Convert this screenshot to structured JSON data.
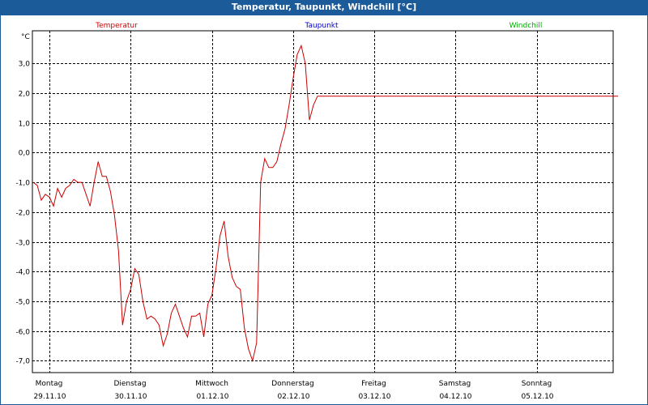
{
  "window": {
    "title": "Temperatur, Taupunkt, Windchill [°C]"
  },
  "colors": {
    "title_bar": "#1b5b9a",
    "temperatur": "#cc0000",
    "taupunkt": "#0000cc",
    "windchill": "#00aa00",
    "grid": "#000000"
  },
  "chart_data": {
    "type": "line",
    "title": "Temperatur, Taupunkt, Windchill [°C]",
    "ylabel": "°C",
    "ylim": [
      -7.4,
      4.1
    ],
    "y_ticks": [
      "3,0",
      "2,0",
      "1,0",
      "0,0",
      "-1,0",
      "-2,0",
      "-3,0",
      "-4,0",
      "-5,0",
      "-6,0",
      "-7,0"
    ],
    "y_tick_values": [
      3,
      2,
      1,
      0,
      -1,
      -2,
      -3,
      -4,
      -5,
      -6,
      -7
    ],
    "xlim": [
      0,
      7
    ],
    "x_ticks": [
      {
        "day": "Montag",
        "date": "29.11.10",
        "x": 0
      },
      {
        "day": "Dienstag",
        "date": "30.11.10",
        "x": 1
      },
      {
        "day": "Mittwoch",
        "date": "01.12.10",
        "x": 2
      },
      {
        "day": "Donnerstag",
        "date": "02.12.10",
        "x": 3
      },
      {
        "day": "Freitag",
        "date": "03.12.10",
        "x": 4
      },
      {
        "day": "Samstag",
        "date": "04.12.10",
        "x": 5
      },
      {
        "day": "Sonntag",
        "date": "05.12.10",
        "x": 6
      }
    ],
    "grid": true,
    "legend": [
      "Temperatur",
      "Taupunkt",
      "Windchill"
    ],
    "legend_placement": "top",
    "series": [
      {
        "name": "Temperatur",
        "x": [
          -0.2,
          -0.15,
          -0.1,
          -0.05,
          0.0,
          0.05,
          0.1,
          0.15,
          0.2,
          0.25,
          0.3,
          0.35,
          0.4,
          0.45,
          0.5,
          0.55,
          0.6,
          0.65,
          0.7,
          0.75,
          0.8,
          0.85,
          0.9,
          0.95,
          1.0,
          1.05,
          1.1,
          1.15,
          1.2,
          1.25,
          1.3,
          1.35,
          1.4,
          1.45,
          1.5,
          1.55,
          1.6,
          1.65,
          1.7,
          1.75,
          1.8,
          1.85,
          1.9,
          1.95,
          2.0,
          2.05,
          2.1,
          2.15,
          2.2,
          2.25,
          2.3,
          2.35,
          2.4,
          2.45,
          2.5,
          2.55,
          2.6,
          2.65,
          2.7,
          2.75,
          2.8,
          2.85,
          2.9,
          2.95,
          3.0,
          3.05,
          3.1,
          3.15,
          3.2,
          3.25,
          3.3,
          3.35,
          3.4,
          3.45,
          3.5,
          3.55,
          3.6,
          3.65,
          3.7,
          3.75,
          3.8,
          3.85,
          3.9,
          3.95,
          4.0,
          4.05,
          4.1,
          4.15,
          4.2,
          4.25,
          4.3,
          4.35,
          4.4,
          4.45,
          4.5,
          4.55,
          4.6,
          4.65,
          4.7,
          4.75,
          4.8,
          4.85,
          4.9,
          4.95,
          5.0,
          5.05,
          5.1,
          5.15,
          5.2,
          5.25,
          5.3,
          5.35,
          5.4,
          5.45,
          5.5,
          5.55,
          5.6,
          5.65,
          5.7,
          5.75,
          5.8,
          5.85,
          5.9,
          5.95,
          6.0,
          6.05,
          6.1,
          6.15,
          6.2,
          6.25,
          6.3,
          6.35,
          6.4,
          6.45,
          6.5,
          6.55,
          6.6,
          6.65,
          6.7,
          6.75,
          6.8,
          6.85,
          6.9,
          6.95,
          7.0
        ],
        "values": [
          -1.0,
          -1.1,
          -1.6,
          -1.4,
          -1.5,
          -1.8,
          -1.2,
          -1.5,
          -1.2,
          -1.1,
          -0.9,
          -1.0,
          -1.0,
          -1.4,
          -1.8,
          -1.0,
          -0.3,
          -0.8,
          -0.8,
          -1.3,
          -2.1,
          -3.3,
          -5.8,
          -5.0,
          -4.6,
          -3.9,
          -4.1,
          -5.0,
          -5.6,
          -5.5,
          -5.6,
          -5.8,
          -6.5,
          -6.1,
          -5.4,
          -5.1,
          -5.5,
          -5.9,
          -6.2,
          -5.5,
          -5.5,
          -5.4,
          -6.2,
          -5.1,
          -4.8,
          -3.9,
          -2.8,
          -2.3,
          -3.5,
          -4.2,
          -4.5,
          -4.6,
          -5.9,
          -6.6,
          -7.0,
          -6.4,
          -1.0,
          -0.2,
          -0.5,
          -0.5,
          -0.3,
          0.3,
          0.8,
          1.6,
          2.5,
          3.3,
          3.6,
          3.0,
          1.1,
          1.6,
          1.9,
          1.9,
          1.9,
          1.9,
          1.9,
          1.9,
          1.9,
          1.9,
          1.9,
          1.9,
          1.9,
          1.9,
          1.9,
          1.9,
          1.9,
          1.9,
          1.9,
          1.9,
          1.9,
          1.9,
          1.9,
          1.9,
          1.9,
          1.9,
          1.9,
          1.9,
          1.9,
          1.9,
          1.9,
          1.9,
          1.9,
          1.9,
          1.9,
          1.9,
          1.9,
          1.9,
          1.9,
          1.9,
          1.9,
          1.9,
          1.9,
          1.9,
          1.9,
          1.9,
          1.9,
          1.9,
          1.9,
          1.9,
          1.9,
          1.9,
          1.9,
          1.9,
          1.9,
          1.9,
          1.9,
          1.9,
          1.9,
          1.9,
          1.9,
          1.9,
          1.9,
          1.9,
          1.9,
          1.9,
          1.9,
          1.9,
          1.9,
          1.9,
          1.9,
          1.9,
          1.9,
          1.9,
          1.9,
          1.9,
          1.9
        ]
      },
      {
        "name": "Taupunkt",
        "values": []
      },
      {
        "name": "Windchill",
        "values": []
      }
    ]
  }
}
